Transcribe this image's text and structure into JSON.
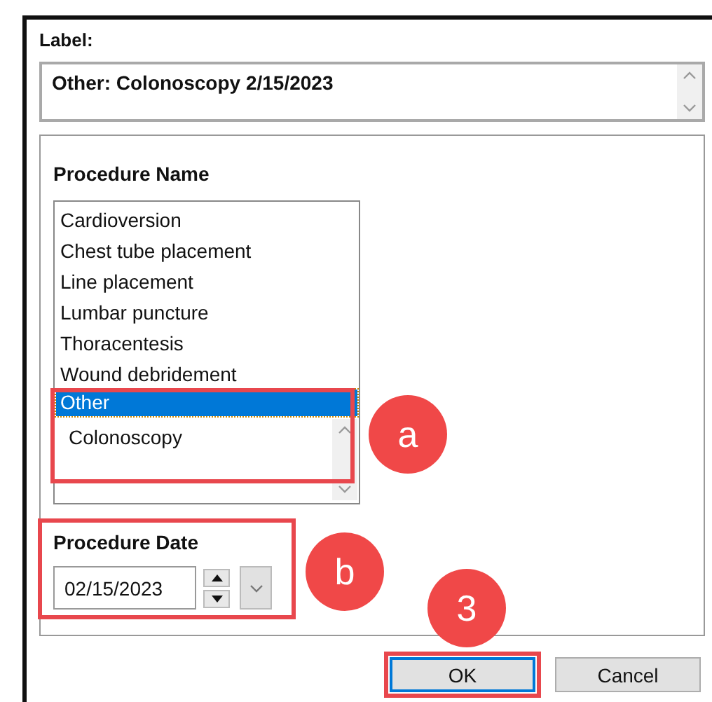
{
  "label_field": {
    "label": "Label:",
    "value": "Other: Colonoscopy 2/15/2023"
  },
  "procedure_name": {
    "label": "Procedure Name",
    "items": [
      {
        "text": "Cardioversion",
        "selected": false
      },
      {
        "text": "Chest tube placement",
        "selected": false
      },
      {
        "text": "Line placement",
        "selected": false
      },
      {
        "text": "Lumbar puncture",
        "selected": false
      },
      {
        "text": "Thoracentesis",
        "selected": false
      },
      {
        "text": "Wound debridement",
        "selected": false
      },
      {
        "text": "Other",
        "selected": true
      }
    ],
    "other_field": {
      "value": "Colonoscopy"
    }
  },
  "procedure_date": {
    "label": "Procedure Date",
    "value": "02/15/2023"
  },
  "buttons": [
    {
      "label": "OK",
      "default": true
    },
    {
      "label": "Cancel",
      "default": false
    }
  ],
  "annotations": [
    {
      "label": "a"
    },
    {
      "label": "b"
    },
    {
      "label": "3"
    }
  ]
}
